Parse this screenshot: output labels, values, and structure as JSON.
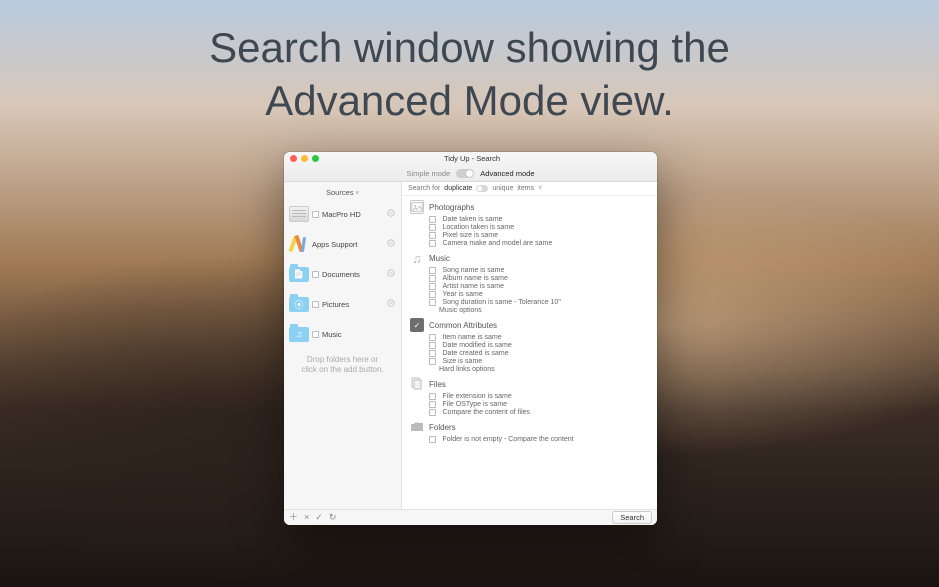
{
  "headline_line1": "Search window showing the",
  "headline_line2": "Advanced  Mode view.",
  "window": {
    "title": "Tidy Up - Search",
    "mode_simple": "Simple mode",
    "mode_advanced": "Advanced mode"
  },
  "sidebar": {
    "header": "Sources",
    "items": [
      {
        "label": "MacPro HD",
        "icon": "hd"
      },
      {
        "label": "Apps Support",
        "icon": "apps"
      },
      {
        "label": "Documents",
        "icon": "folder-doc"
      },
      {
        "label": "Pictures",
        "icon": "folder-pic"
      },
      {
        "label": "Music",
        "icon": "folder-music"
      }
    ],
    "drophint_l1": "Drop folders here or",
    "drophint_l2": "click on the add button."
  },
  "filter": {
    "prefix": "Search for",
    "duplicate": "duplicate",
    "unique": "unique",
    "suffix": "items"
  },
  "sections": {
    "photographs": {
      "title": "Photographs",
      "opts": [
        "Date taken is same",
        "Location taken is same",
        "Pixel size is same",
        "Camera make and model are same"
      ]
    },
    "music": {
      "title": "Music",
      "opts": [
        "Song name is same",
        "Album name is same",
        "Artist name is same",
        "Year is same",
        "Song duration is same - Tolerance 10\""
      ],
      "extra": "Music options"
    },
    "common": {
      "title": "Common Attributes",
      "opts": [
        "Item name is same",
        "Date modified is same",
        "Date created is same",
        "Size is same"
      ],
      "extra": "Hard links options"
    },
    "files": {
      "title": "Files",
      "opts": [
        "File extension is same",
        "File OSType is same",
        "Compare the content of files"
      ]
    },
    "folders": {
      "title": "Folders",
      "opts": [
        "Folder is not empty - Compare the content"
      ]
    }
  },
  "footer": {
    "search": "Search"
  }
}
